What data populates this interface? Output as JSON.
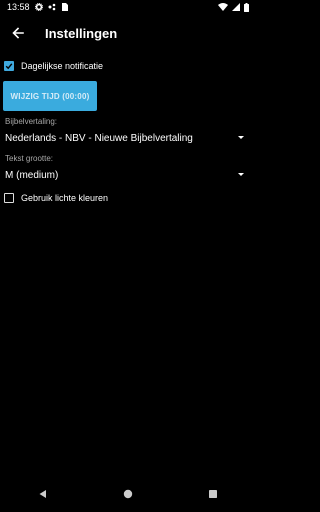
{
  "status_bar": {
    "time": "13:58",
    "icons": [
      "settings-gear-icon",
      "signal-dots-icon",
      "sim-card-icon",
      "wifi-icon",
      "cellular-icon",
      "battery-icon"
    ]
  },
  "header": {
    "title": "Instellingen",
    "back_icon": "arrow-left-icon"
  },
  "settings": {
    "daily_notification": {
      "label": "Dagelijkse notificatie",
      "checked": true
    },
    "change_time_button": "WIJZIG TIJD (00:00)",
    "bible_translation": {
      "label": "Bijbelvertaling:",
      "value": "Nederlands - NBV - Nieuwe Bijbelvertaling"
    },
    "text_size": {
      "label": "Tekst grootte:",
      "value": "M (medium)"
    },
    "light_colors": {
      "label": "Gebruik lichte kleuren",
      "checked": false
    }
  },
  "nav_bar": {
    "icons": [
      "back-triangle-icon",
      "home-circle-icon",
      "recents-square-icon"
    ]
  },
  "colors": {
    "accent": "#3aabde",
    "background": "#000000",
    "label_gray": "#a8a8a8"
  }
}
